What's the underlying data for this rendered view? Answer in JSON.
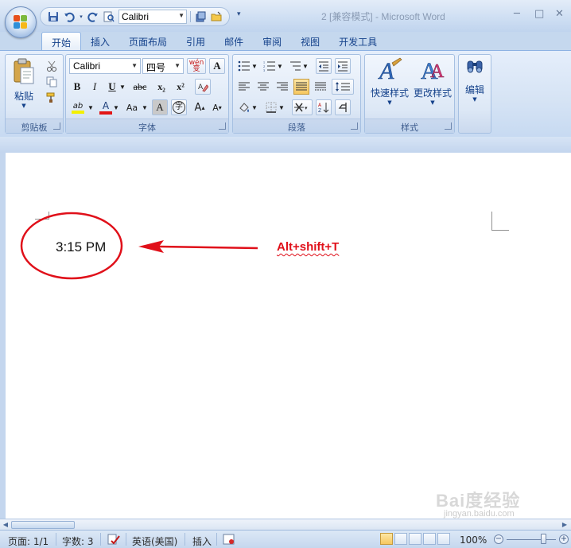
{
  "window": {
    "title": "2 [兼容模式] - Microsoft Word",
    "controls": {
      "minimize": "─",
      "maximize": "□",
      "close": "✕"
    }
  },
  "quick_access": {
    "font_name": "Calibri",
    "icons": [
      "save-icon",
      "undo-icon",
      "redo-icon",
      "print-preview-icon",
      "shapes-icon",
      "open-folder-icon",
      "customize-icon"
    ]
  },
  "tabs": [
    {
      "label": "开始",
      "active": true
    },
    {
      "label": "插入"
    },
    {
      "label": "页面布局"
    },
    {
      "label": "引用"
    },
    {
      "label": "邮件"
    },
    {
      "label": "审阅"
    },
    {
      "label": "视图"
    },
    {
      "label": "开发工具"
    }
  ],
  "ribbon": {
    "clipboard": {
      "label": "剪贴板",
      "paste_label": "粘贴"
    },
    "font": {
      "label": "字体",
      "font_name": "Calibri",
      "font_size": "四号",
      "phonetic": "wén 变",
      "bold": "B",
      "italic": "I",
      "underline": "U",
      "strike": "abc",
      "subscript": "x₂",
      "superscript": "x²",
      "highlight": "ab",
      "font_color": "A",
      "change_case": "Aa",
      "char_shading": "A",
      "enclose": "字",
      "grow": "A",
      "shrink": "A",
      "highlight_color": "#f3f000",
      "font_color_value": "#e21515"
    },
    "paragraph": {
      "label": "段落"
    },
    "styles": {
      "label": "样式",
      "quick_styles": "快速样式",
      "change_styles": "更改样式"
    },
    "editing": {
      "label": "编辑"
    }
  },
  "document": {
    "date_text": "3:15 PM",
    "annotation": "Alt+shift+T",
    "annotation_color": "#e0101a"
  },
  "status": {
    "page": "页面: 1/1",
    "words": "字数: 3",
    "language": "英语(美国)",
    "mode": "插入",
    "zoom": "100%"
  },
  "watermark": {
    "main": "Bai度经验",
    "sub": "jingyan.baidu.com"
  }
}
